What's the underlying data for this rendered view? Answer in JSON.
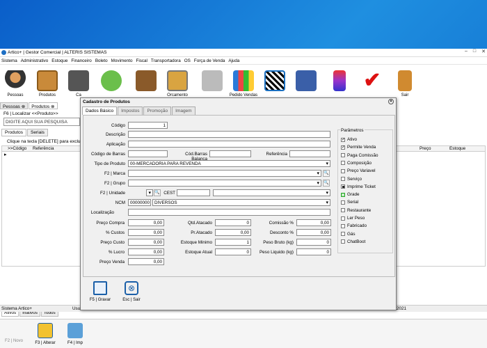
{
  "window": {
    "title": "Artico+ | Gestor Comercial | ALTERIS SISTEMAS"
  },
  "menu": [
    "Sistema",
    "Administrativo",
    "Estoque",
    "Financeiro",
    "Boleto",
    "Movimento",
    "Fiscal",
    "Transportadora",
    "OS",
    "Força de Venda",
    "Ajuda"
  ],
  "toolbar": {
    "pessoas": "Pessoas",
    "produtos": "Produtos",
    "caixa": "Ca",
    "orcamento": "Orcamento",
    "pedido": "Pedido Vendas",
    "sair": "Sair"
  },
  "tabs": {
    "pessoas": "Pessoas",
    "produtos": "Produtos"
  },
  "left": {
    "search_label": "F6 | Localizar <<Produto>>",
    "search_value": "DIGITE AQUI SUA PESQUISA",
    "subtab_produtos": "Produtos",
    "subtab_seriais": "Seriais",
    "hint": "Clique na tecla [DELETE] para excluir P",
    "col_codigo": ">>Código",
    "col_referencia": "Referência",
    "col_preco": "Preço",
    "col_estoque": "Estoque",
    "row_marker": "▸",
    "filter_ativos": "Ativos",
    "filter_inativos": "Inativos",
    "filter_todos": "Todos",
    "btn_novo": "F2 | Novo",
    "btn_alterar": "F3 | Alterar",
    "btn_imp": "F4 | Imp"
  },
  "status": {
    "left": "Sistema Artico+",
    "user": "Usu",
    "right": "2021"
  },
  "modal": {
    "title": "Cadastro de Produtos",
    "close": "×",
    "tabs": [
      "Dados Básico",
      "Impostos",
      "Promoção",
      "Imagem"
    ],
    "labels": {
      "codigo": "Código",
      "descricao": "Descrição",
      "aplicacao": "Aplicação",
      "codigo_barras": "Código de Barras",
      "cod_barras_balanca": "Cód.Barras Balança",
      "referencia": "Referência",
      "tipo_produto": "Tipo de Produto",
      "marca": "F2 | Marca",
      "grupo": "F2 | Grupo",
      "unidade": "F2 | Unidade",
      "cest": "CEST",
      "ncm": "NCM",
      "localizacao": "Localização",
      "preco_compra": "Preço Compra",
      "pct_custos": "% Custos",
      "preco_custo": "Preço Custo",
      "pct_lucro": "% Lucro",
      "preco_venda": "Preço Venda",
      "qtd_atacado": "Qtd.Atacado",
      "pr_atacado": "Pr.Atacado",
      "estoque_minimo": "Estoque Minimo",
      "estoque_atual": "Estoque Atual",
      "comissao": "Comissão %",
      "desconto": "Desconto %",
      "peso_bruto": "Peso Bruto (kg)",
      "peso_liquido": "Peso Liquido (kg)"
    },
    "values": {
      "codigo": "1",
      "tipo_produto": "00-MERCADORIA PARA REVENDA",
      "ncm": "00000000",
      "ncm_desc": "DIVERSOS",
      "preco_compra": "0,00",
      "pct_custos": "0,00",
      "preco_custo": "0,00",
      "pct_lucro": "0,00",
      "preco_venda": "0,00",
      "qtd_atacado": "0",
      "pr_atacado": "0,00",
      "estoque_minimo": "1",
      "estoque_atual": "0",
      "comissao": "0,00",
      "desconto": "0,00",
      "peso_bruto": "0",
      "peso_liquido": "0"
    },
    "params_title": "Parâmetros",
    "params": [
      {
        "label": "Ativo",
        "state": "chk"
      },
      {
        "label": "Permite Venda",
        "state": "chk"
      },
      {
        "label": "Paga Comissão",
        "state": ""
      },
      {
        "label": "Composição",
        "state": ""
      },
      {
        "label": "Preço Variavel",
        "state": ""
      },
      {
        "label": "Serviço",
        "state": ""
      },
      {
        "label": "Imprime Ticket",
        "state": "sq"
      },
      {
        "label": "Grade",
        "state": "grn"
      },
      {
        "label": "Serial",
        "state": ""
      },
      {
        "label": "Restaurante",
        "state": ""
      },
      {
        "label": "Ler Peso",
        "state": ""
      },
      {
        "label": "Fabricado",
        "state": ""
      },
      {
        "label": "Gás",
        "state": ""
      },
      {
        "label": "ChatBoot",
        "state": ""
      }
    ],
    "footer": {
      "gravar": "F5 | Gravar",
      "sair": "Esc | Sair"
    }
  }
}
